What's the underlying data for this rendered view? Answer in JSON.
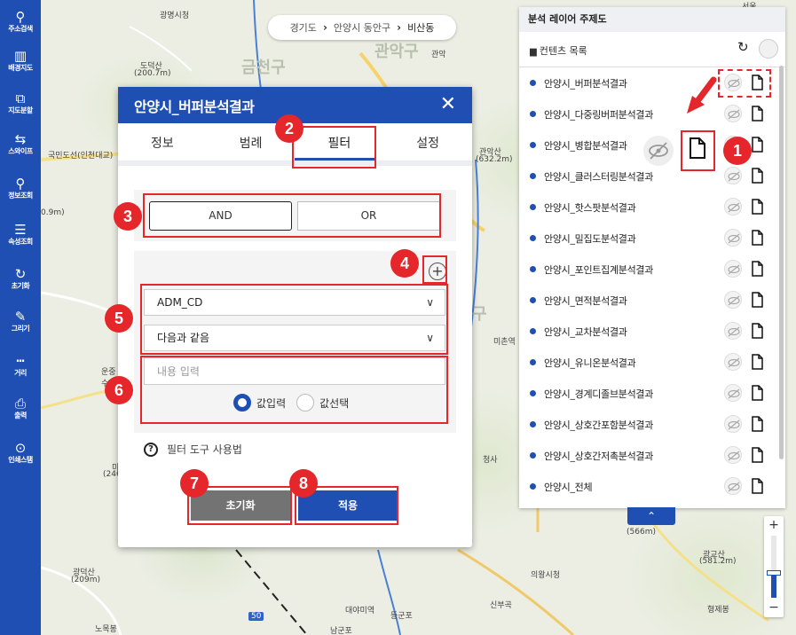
{
  "sidebar": {
    "items": [
      {
        "label": "주소검색",
        "icon": "search-icon",
        "glyph": "⚲"
      },
      {
        "label": "배경지도",
        "icon": "map-icon",
        "glyph": "▥"
      },
      {
        "label": "지도분할",
        "icon": "split-map-icon",
        "glyph": "⧉"
      },
      {
        "label": "스와이프",
        "icon": "swipe-icon",
        "glyph": "⇆"
      },
      {
        "label": "정보조회",
        "icon": "info-query-icon",
        "glyph": "⚲"
      },
      {
        "label": "속성조회",
        "icon": "attribute-query-icon",
        "glyph": "☰"
      },
      {
        "label": "초기화",
        "icon": "reset-icon",
        "glyph": "↻"
      },
      {
        "label": "그리기",
        "icon": "draw-icon",
        "glyph": "✎"
      },
      {
        "label": "거리",
        "icon": "distance-icon",
        "glyph": "┅"
      },
      {
        "label": "출력",
        "icon": "print-icon",
        "glyph": "⎙"
      },
      {
        "label": "인쇄스탬",
        "icon": "location-pin-icon",
        "glyph": "⊙"
      }
    ]
  },
  "breadcrumb": {
    "level1": "경기도",
    "level2": "안양시 동안구",
    "level3": "비산동",
    "separator": "›"
  },
  "dialog": {
    "title": "안양시_버퍼분석결과",
    "close_glyph": "✕",
    "tabs": [
      "정보",
      "범례",
      "필터",
      "설정"
    ],
    "active_tab": "필터",
    "op_and": "AND",
    "op_or": "OR",
    "plus_glyph": "+",
    "field_select": "ADM_CD",
    "operator_select": "다음과 같음",
    "chevron_glyph": "∨",
    "value_placeholder": "내용 입력",
    "radio_input": "값입력",
    "radio_select": "값선택",
    "help_glyph": "?",
    "help_text": "필터 도구 사용법",
    "reset_button": "초기화",
    "apply_button": "적용"
  },
  "annotations": [
    "1",
    "2",
    "3",
    "4",
    "5",
    "6",
    "7",
    "8"
  ],
  "right_panel": {
    "title": "분석 레이어 주제도",
    "contents_label": "컨텐츠 목록",
    "refresh_glyph": "↻",
    "layers": [
      "안양시_버퍼분석결과",
      "안양시_다중링버퍼분석결과",
      "안양시_병합분석결과",
      "안양시_클러스터링분석결과",
      "안양시_핫스팟분석결과",
      "안양시_밀집도분석결과",
      "안양시_포인트집계분석결과",
      "안양시_면적분석결과",
      "안양시_교차분석결과",
      "안양시_유니온분석결과",
      "안양시_경계디졸브분석결과",
      "안양시_상호간포함분석결과",
      "안양시_상호간저촉분석결과",
      "안양시_전체"
    ],
    "collapse_glyph": "⌃"
  },
  "zoom": {
    "plus": "+",
    "minus": "−",
    "level": 0.45
  },
  "map_labels": [
    {
      "text": "광명시청",
      "name": "map-label-gwangmyeong-cityhall"
    },
    {
      "text": "도덕산",
      "name": "map-label-dodeoksan"
    },
    {
      "text": "(200.7m)",
      "name": "map-label-dodeoksan-height"
    },
    {
      "text": "금천구",
      "name": "map-label-geumcheon-gu"
    },
    {
      "text": "관악구",
      "name": "map-label-gwanak-gu"
    },
    {
      "text": "관악",
      "name": "map-label-gwanak"
    },
    {
      "text": "관악산",
      "name": "map-label-gwanaksan"
    },
    {
      "text": "(632.2m)",
      "name": "map-label-gwanaksan-height"
    },
    {
      "text": "서울",
      "name": "map-label-seoul"
    },
    {
      "text": "(566m)",
      "name": "map-label-566m"
    },
    {
      "text": "광교산",
      "name": "map-label-gwanggyosan"
    },
    {
      "text": "(581.2m)",
      "name": "map-label-gwanggyosan-height"
    },
    {
      "text": "의왕시청",
      "name": "map-label-uiwang-cityhall"
    },
    {
      "text": "광덕산",
      "name": "map-label-gwangdeoksan"
    },
    {
      "text": "(209m)",
      "name": "map-label-gwangdeoksan-height"
    },
    {
      "text": "등군포",
      "name": "map-label-deunggunpo"
    },
    {
      "text": "신부곡",
      "name": "map-label-sinbugok"
    },
    {
      "text": "형제봉",
      "name": "map-label-hyeongjebong"
    },
    {
      "text": "대야미역",
      "name": "map-label-daeyami"
    },
    {
      "text": "노목봉",
      "name": "map-label-nomokbong"
    },
    {
      "text": "청사",
      "name": "map-label-cheongsa"
    },
    {
      "text": "구",
      "name": "map-label-gu"
    },
    {
      "text": "(246",
      "name": "map-label-246"
    },
    {
      "text": "운중",
      "name": "map-label-unjung"
    },
    {
      "text": "수원대",
      "name": "map-label-suwondae"
    },
    {
      "text": "미",
      "name": "map-label-mi"
    },
    {
      "text": "0.9m)",
      "name": "map-label-09m"
    },
    {
      "text": "국민도선(인천대교)",
      "name": "map-label-expressway"
    },
    {
      "text": "50",
      "name": "map-label-route-50"
    },
    {
      "text": "미촌역",
      "name": "map-label-michon"
    },
    {
      "text": "남군포",
      "name": "map-label-namgunpo"
    }
  ]
}
